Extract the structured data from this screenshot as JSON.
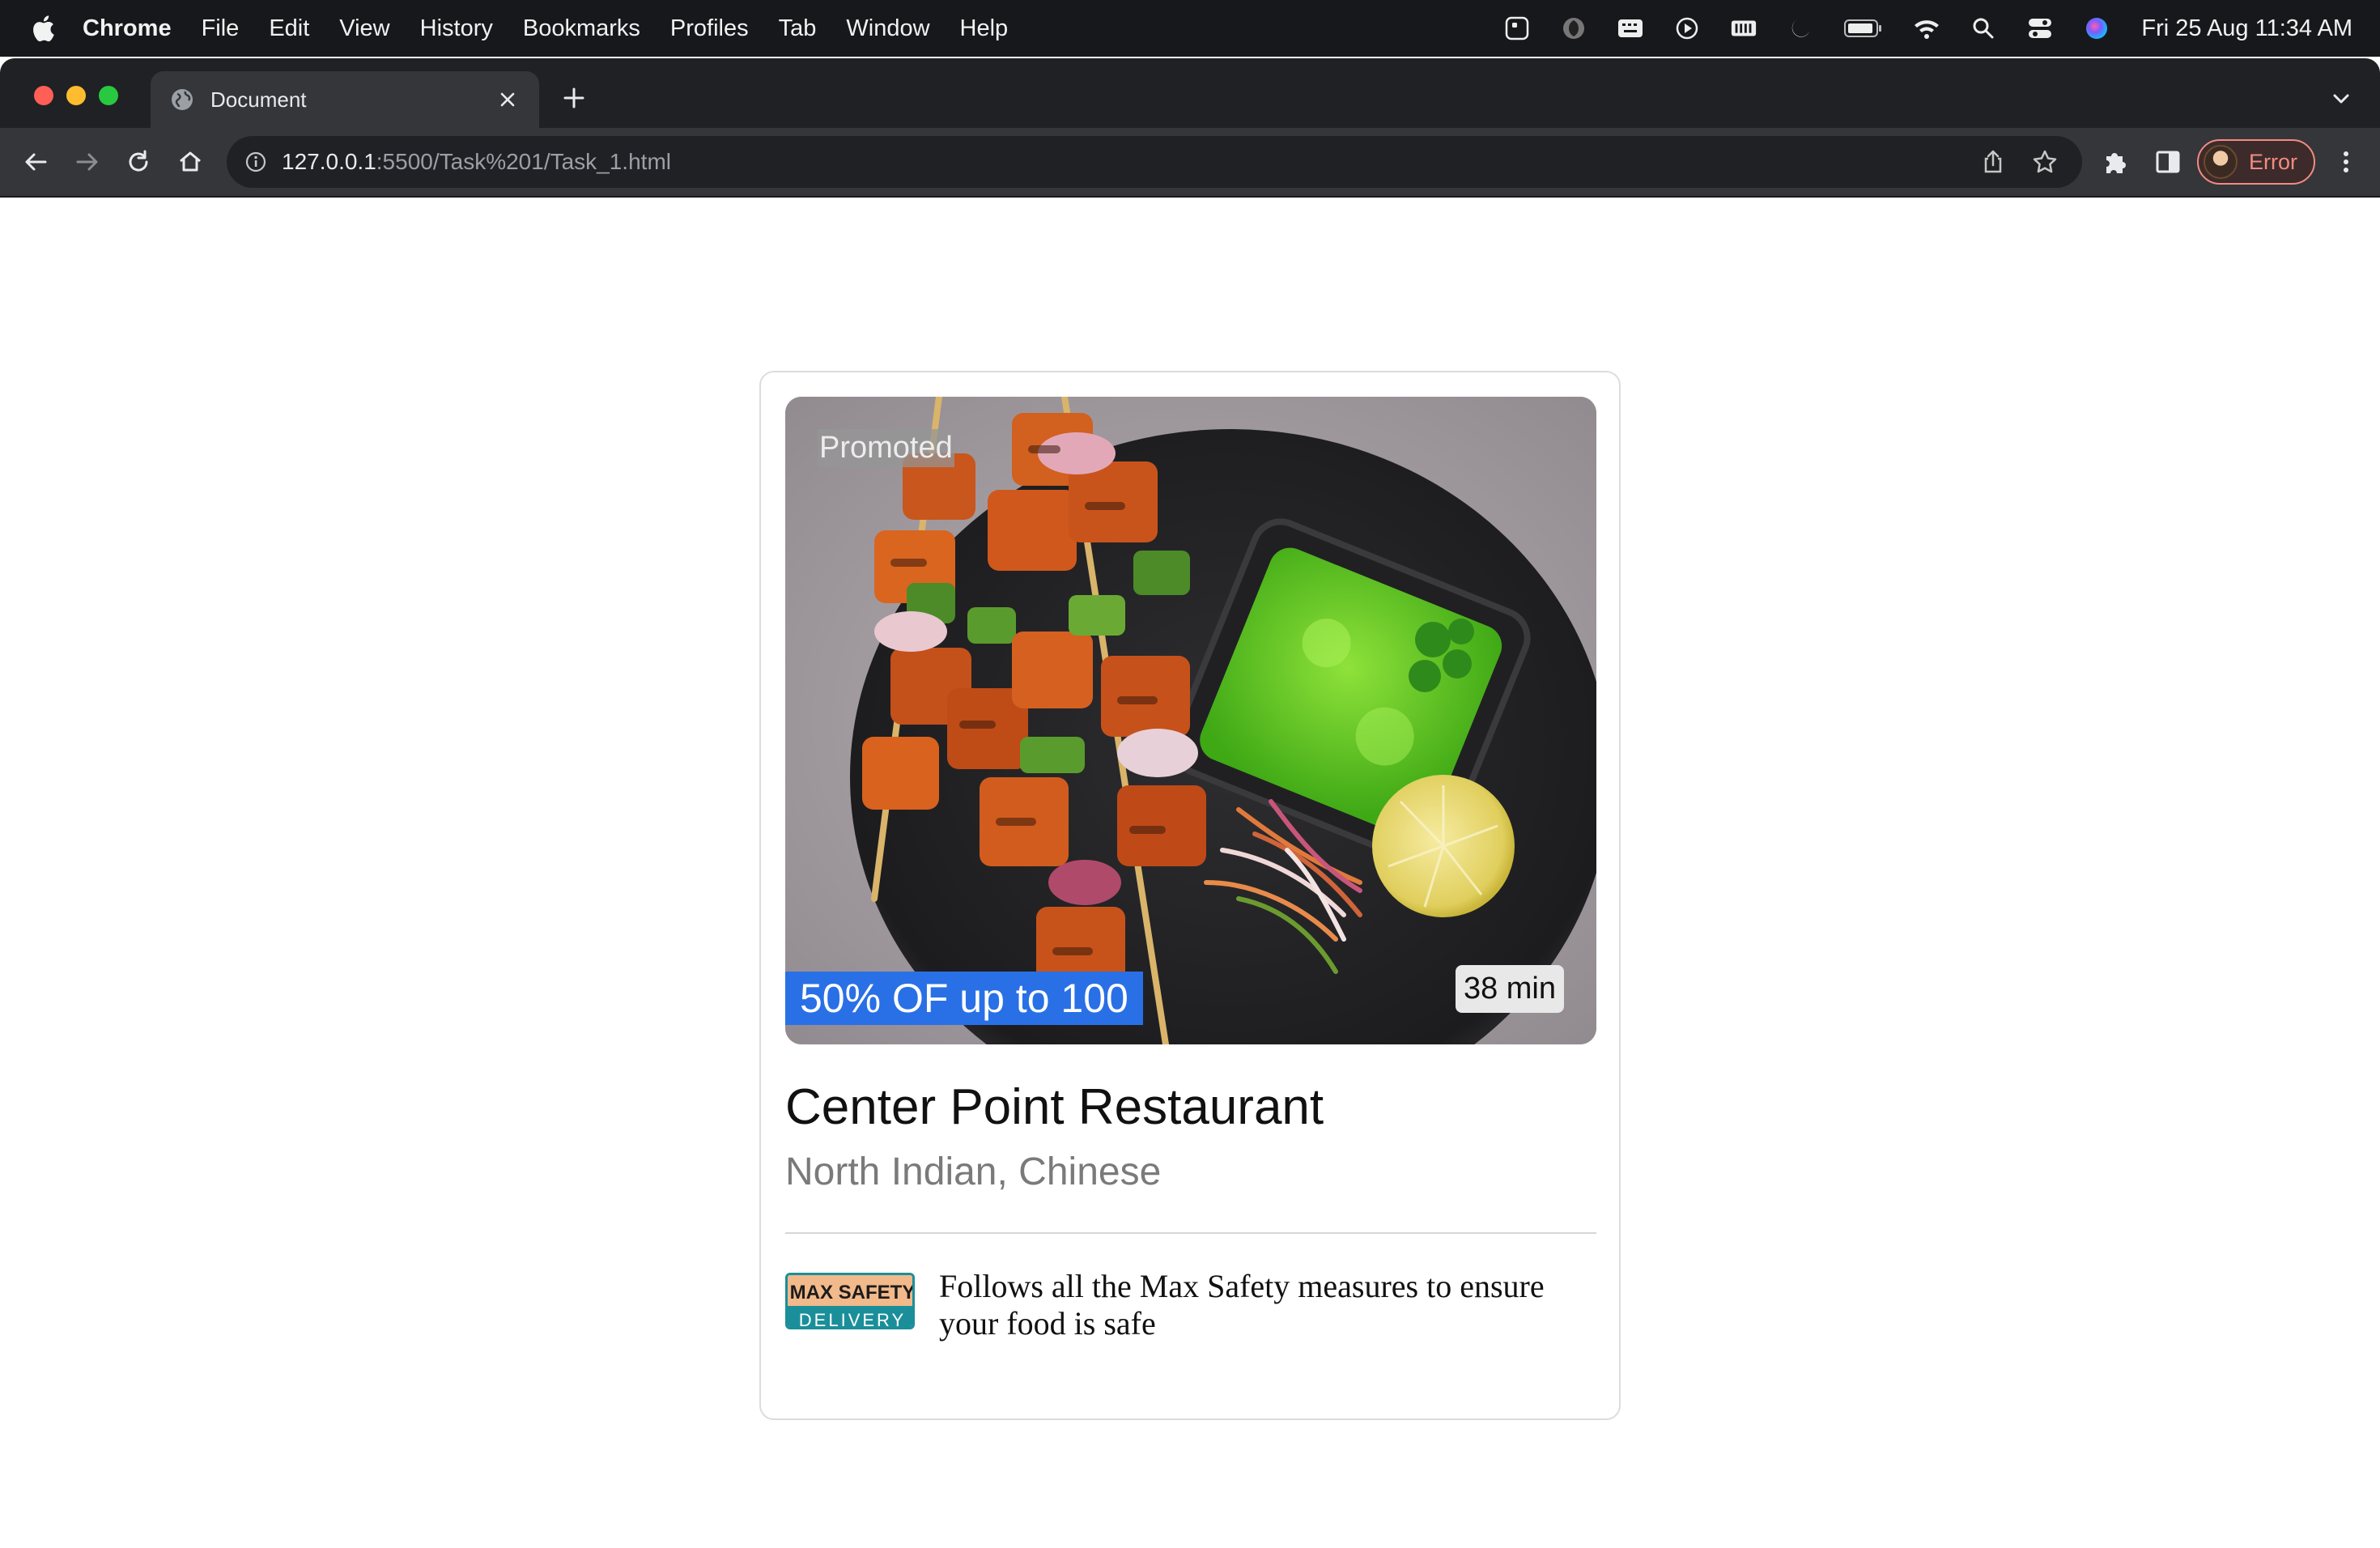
{
  "menubar": {
    "app_name": "Chrome",
    "items": [
      "File",
      "Edit",
      "View",
      "History",
      "Bookmarks",
      "Profiles",
      "Tab",
      "Window",
      "Help"
    ],
    "clock": "Fri 25 Aug  11:34 AM"
  },
  "browser": {
    "tab_title": "Document",
    "url_host": "127.0.0.1",
    "url_path": ":5500/Task%201/Task_1.html",
    "profile_label": "Error"
  },
  "card": {
    "promoted_label": "Promoted",
    "offer_label": "50% OF up to 100",
    "eta_label": "38 min",
    "restaurant_name": "Center Point Restaurant",
    "cuisine": "North Indian, Chinese",
    "badge_top": "MAX SAFETY",
    "badge_bottom": "DELIVERY",
    "safety_text": "Follows all the Max Safety measures to ensure your food is safe"
  },
  "colors": {
    "offer_bg": "#2970e6",
    "profile_accent": "#f28b82",
    "badge_teal": "#1a8f9a"
  }
}
